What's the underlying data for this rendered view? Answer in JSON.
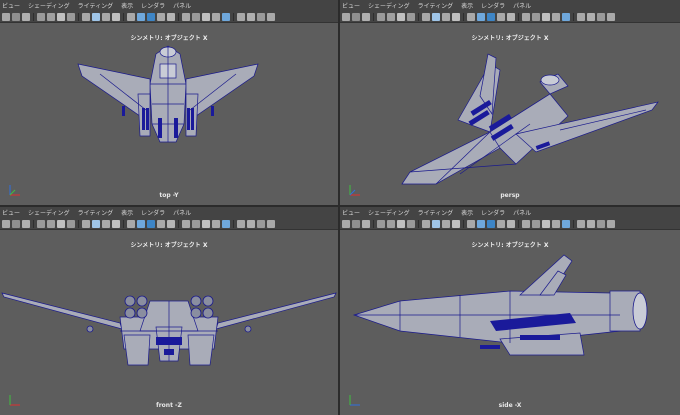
{
  "menu": [
    "ビュー",
    "シェーディング",
    "ライティング",
    "表示",
    "レンダラ",
    "パネル"
  ],
  "symmetry_label": "シンメトリ: オブジェクト X",
  "viewports": [
    {
      "id": "top",
      "camera": "top -Y"
    },
    {
      "id": "persp",
      "camera": "persp"
    },
    {
      "id": "front",
      "camera": "front -Z"
    },
    {
      "id": "side",
      "camera": "side -X"
    }
  ],
  "colors": {
    "viewport_bg": "#5d5d5d",
    "panel_bar": "#444444",
    "wire": "#1a1a8c",
    "mesh_fill": "#a9acb8",
    "axis_x": "#e03030",
    "axis_y": "#40c040",
    "axis_z": "#3070e0"
  }
}
